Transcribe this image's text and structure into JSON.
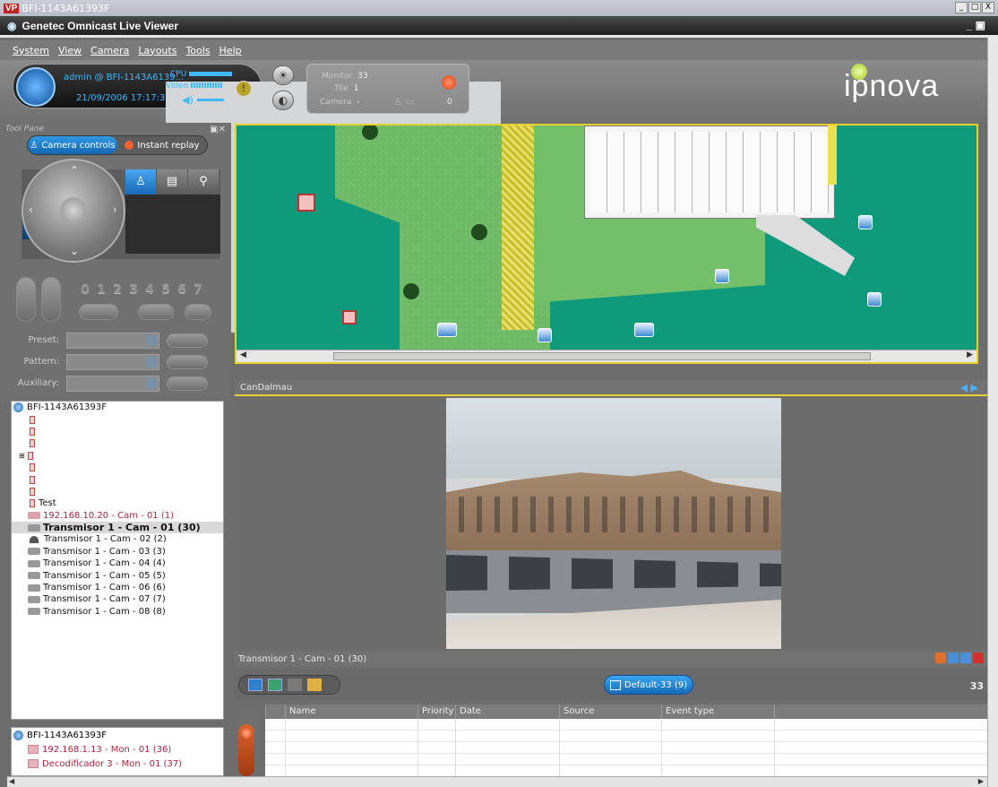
{
  "window": {
    "title": "BFI-1143A61393F",
    "app_title": "Genetec Omnicast Live Viewer",
    "buttons": [
      "_",
      "□",
      "X"
    ]
  },
  "menu": [
    "System",
    "View",
    "Camera",
    "Layouts",
    "Tools",
    "Help"
  ],
  "user_panel": {
    "user": "admin @ BFI-1143A6139...",
    "datetime": "21/09/2006 17:17:34",
    "cpu_label": "CPU",
    "video_label": "Video"
  },
  "monitor_panel": {
    "monitor_label": "Monitor",
    "monitor_value": "33",
    "tile_label": "Tile",
    "tile_value": "1",
    "camera_label": "Camera",
    "camera_value": "-",
    "count": "0"
  },
  "brand": "ipnova",
  "tool_pane": {
    "title": "Tool Pane",
    "tabs": [
      "Camera controls",
      "Instant replay"
    ],
    "numbers": [
      "0",
      "1",
      "2",
      "3",
      "4",
      "5",
      "6",
      "7"
    ],
    "fields": [
      "Preset:",
      "Pattern:",
      "Auxiliary:"
    ]
  },
  "tree": {
    "root": "BFI-1143A61393F",
    "rows": [
      {
        "label": "",
        "type": "srv"
      },
      {
        "label": "",
        "type": "srv"
      },
      {
        "label": "",
        "type": "srv"
      },
      {
        "label": "",
        "type": "srv"
      },
      {
        "label": "",
        "type": "srv"
      },
      {
        "label": "",
        "type": "srv"
      },
      {
        "label": "",
        "type": "srv"
      },
      {
        "label": "Test",
        "type": "srv"
      },
      {
        "label": "192.168.10.20 - Cam - 01 (1)",
        "type": "cam-red"
      },
      {
        "label": "Transmisor 1 - Cam - 01 (30)",
        "type": "cam-bold"
      },
      {
        "label": "Transmisor 1 - Cam - 02 (2)",
        "type": "dome"
      },
      {
        "label": "Transmisor 1 - Cam - 03 (3)",
        "type": "cam"
      },
      {
        "label": "Transmisor 1 - Cam - 04 (4)",
        "type": "cam"
      },
      {
        "label": "Transmisor 1 - Cam - 05 (5)",
        "type": "cam"
      },
      {
        "label": "Transmisor 1 - Cam - 06 (6)",
        "type": "cam"
      },
      {
        "label": "Transmisor 1 - Cam - 07 (7)",
        "type": "cam"
      },
      {
        "label": "Transmisor 1 - Cam - 08 (8)",
        "type": "cam"
      }
    ]
  },
  "monitor_tree": {
    "root": "BFI-1143A61393F",
    "rows": [
      "192.168.1.13 - Mon - 01 (36)",
      "Decodificador 3 - Mon - 01 (37)"
    ]
  },
  "map_tile": {
    "label": "CanDalmau"
  },
  "video_tile": {
    "label": "Transmisor 1 - Cam - 01 (30)"
  },
  "layout": {
    "default_label": "Default-33 (9)",
    "tile_count": "33"
  },
  "events": {
    "columns": [
      "Name",
      "Priority",
      "Date",
      "Source",
      "Event type"
    ]
  },
  "colors": {
    "accent": "#1a6fc0",
    "map_bg": "#0f9a7c",
    "highlight": "#e8d030"
  }
}
